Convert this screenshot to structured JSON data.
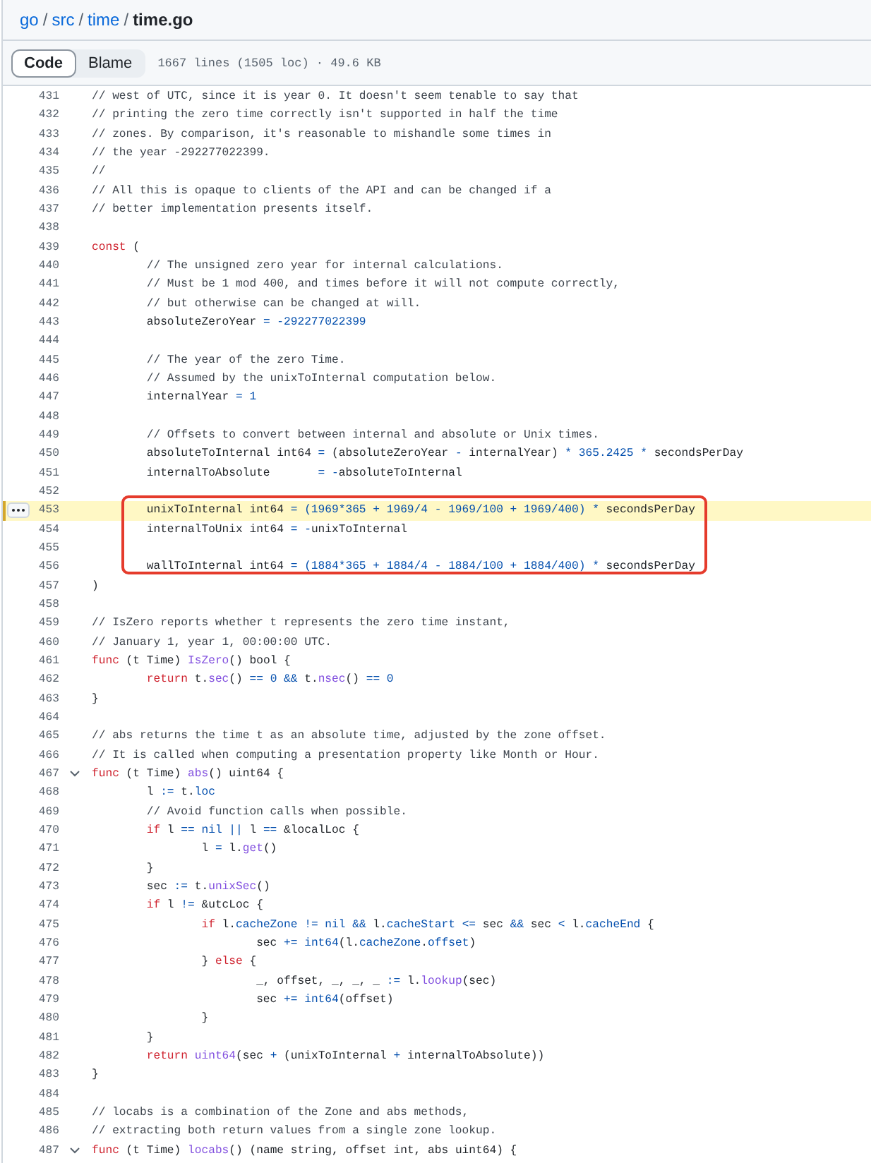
{
  "breadcrumb": {
    "items": [
      "go",
      "src",
      "time",
      "time.go"
    ],
    "separator": "/"
  },
  "tabs": [
    {
      "label": "Code",
      "selected": true
    },
    {
      "label": "Blame",
      "selected": false
    }
  ],
  "file_info": "1667 lines (1505 loc) · 49.6 KB",
  "code": {
    "lines": [
      {
        "number": "431",
        "selected": false,
        "boxed": false,
        "tokens": [
          {
            "kind": "comment",
            "text": "// west of UTC, since it is year 0. It doesn't seem tenable to say that"
          }
        ]
      },
      {
        "number": "432",
        "selected": false,
        "boxed": false,
        "tokens": [
          {
            "kind": "comment",
            "text": "// printing the zero time correctly isn't supported in half the time"
          }
        ]
      },
      {
        "number": "433",
        "selected": false,
        "boxed": false,
        "tokens": [
          {
            "kind": "comment",
            "text": "// zones. By comparison, it's reasonable to mishandle some times in"
          }
        ]
      },
      {
        "number": "434",
        "selected": false,
        "boxed": false,
        "tokens": [
          {
            "kind": "comment",
            "text": "// the year -292277022399."
          }
        ]
      },
      {
        "number": "435",
        "selected": false,
        "boxed": false,
        "tokens": [
          {
            "kind": "comment",
            "text": "//"
          }
        ]
      },
      {
        "number": "436",
        "selected": false,
        "boxed": false,
        "tokens": [
          {
            "kind": "comment",
            "text": "// All this is opaque to clients of the API and can be changed if a"
          }
        ]
      },
      {
        "number": "437",
        "selected": false,
        "boxed": false,
        "tokens": [
          {
            "kind": "comment",
            "text": "// better implementation presents itself."
          }
        ]
      },
      {
        "number": "438",
        "selected": false,
        "boxed": false
      },
      {
        "number": "439",
        "selected": false,
        "boxed": false,
        "tokens": [
          {
            "kind": "keyword",
            "text": "const"
          },
          {
            "kind": "plain",
            "text": " ("
          }
        ]
      },
      {
        "number": "440",
        "selected": false,
        "boxed": false,
        "tokens": [
          {
            "kind": "comment",
            "text": "\t// The unsigned zero year for internal calculations."
          }
        ]
      },
      {
        "number": "441",
        "selected": false,
        "boxed": false,
        "tokens": [
          {
            "kind": "comment",
            "text": "\t// Must be 1 mod 400, and times before it will not compute correctly,"
          }
        ]
      },
      {
        "number": "442",
        "selected": false,
        "boxed": false,
        "tokens": [
          {
            "kind": "comment",
            "text": "\t// but otherwise can be changed at will."
          }
        ]
      },
      {
        "number": "443",
        "selected": false,
        "boxed": false,
        "tokens": [
          {
            "kind": "plain",
            "text": "\tabsoluteZeroYear "
          },
          {
            "kind": "literal",
            "text": "= -292277022399"
          }
        ]
      },
      {
        "number": "444",
        "selected": false,
        "boxed": false
      },
      {
        "number": "445",
        "selected": false,
        "boxed": false,
        "tokens": [
          {
            "kind": "comment",
            "text": "\t// The year of the zero Time."
          }
        ]
      },
      {
        "number": "446",
        "selected": false,
        "boxed": false,
        "tokens": [
          {
            "kind": "comment",
            "text": "\t// Assumed by the unixToInternal computation below."
          }
        ]
      },
      {
        "number": "447",
        "selected": false,
        "boxed": false,
        "tokens": [
          {
            "kind": "plain",
            "text": "\tinternalYear "
          },
          {
            "kind": "literal",
            "text": "= 1"
          }
        ]
      },
      {
        "number": "448",
        "selected": false,
        "boxed": false
      },
      {
        "number": "449",
        "selected": false,
        "boxed": false,
        "tokens": [
          {
            "kind": "comment",
            "text": "\t// Offsets to convert between internal and absolute or Unix times."
          }
        ]
      },
      {
        "number": "450",
        "selected": false,
        "boxed": false,
        "tokens": [
          {
            "kind": "plain",
            "text": "\tabsoluteToInternal int64 "
          },
          {
            "kind": "literal",
            "text": "="
          },
          {
            "kind": "plain",
            "text": " (absoluteZeroYear "
          },
          {
            "kind": "literal",
            "text": "-"
          },
          {
            "kind": "plain",
            "text": " internalYear) "
          },
          {
            "kind": "literal",
            "text": "* 365.2425 *"
          },
          {
            "kind": "plain",
            "text": " secondsPerDay"
          }
        ]
      },
      {
        "number": "451",
        "selected": false,
        "boxed": false,
        "tokens": [
          {
            "kind": "plain",
            "text": "\tinternalToAbsolute       "
          },
          {
            "kind": "literal",
            "text": "= -"
          },
          {
            "kind": "plain",
            "text": "absoluteToInternal"
          }
        ]
      },
      {
        "number": "452",
        "selected": false,
        "boxed": false
      },
      {
        "number": "453",
        "selected": true,
        "boxed": true,
        "tokens": [
          {
            "kind": "plain",
            "text": "\tunixToInternal int64 "
          },
          {
            "kind": "literal",
            "text": "= (1969*365 + 1969/4 - 1969/100 + 1969/400) *"
          },
          {
            "kind": "plain",
            "text": " secondsPerDay"
          }
        ]
      },
      {
        "number": "454",
        "selected": false,
        "boxed": true,
        "tokens": [
          {
            "kind": "plain",
            "text": "\tinternalToUnix int64 "
          },
          {
            "kind": "literal",
            "text": "= -"
          },
          {
            "kind": "plain",
            "text": "unixToInternal"
          }
        ]
      },
      {
        "number": "455",
        "selected": false,
        "boxed": true
      },
      {
        "number": "456",
        "selected": false,
        "boxed": true,
        "tokens": [
          {
            "kind": "plain",
            "text": "\twallToInternal int64 "
          },
          {
            "kind": "literal",
            "text": "= (1884*365 + 1884/4 - 1884/100 + 1884/400) *"
          },
          {
            "kind": "plain",
            "text": " secondsPerDay"
          }
        ]
      },
      {
        "number": "457",
        "selected": false,
        "boxed": false,
        "tokens": [
          {
            "kind": "plain",
            "text": ")"
          }
        ]
      },
      {
        "number": "458",
        "selected": false,
        "boxed": false
      },
      {
        "number": "459",
        "selected": false,
        "boxed": false,
        "tokens": [
          {
            "kind": "comment",
            "text": "// IsZero reports whether t represents the zero time instant,"
          }
        ]
      },
      {
        "number": "460",
        "selected": false,
        "boxed": false,
        "tokens": [
          {
            "kind": "comment",
            "text": "// January 1, year 1, 00:00:00 UTC."
          }
        ]
      },
      {
        "number": "461",
        "selected": false,
        "boxed": false,
        "tokens": [
          {
            "kind": "keyword",
            "text": "func"
          },
          {
            "kind": "plain",
            "text": " (t Time) "
          },
          {
            "kind": "call",
            "text": "IsZero"
          },
          {
            "kind": "plain",
            "text": "() bool {"
          }
        ]
      },
      {
        "number": "462",
        "selected": false,
        "boxed": false,
        "tokens": [
          {
            "kind": "keyword",
            "text": "\treturn"
          },
          {
            "kind": "plain",
            "text": " t."
          },
          {
            "kind": "call",
            "text": "sec"
          },
          {
            "kind": "plain",
            "text": "() "
          },
          {
            "kind": "literal",
            "text": "== 0 &&"
          },
          {
            "kind": "plain",
            "text": " t."
          },
          {
            "kind": "call",
            "text": "nsec"
          },
          {
            "kind": "plain",
            "text": "() "
          },
          {
            "kind": "literal",
            "text": "== 0"
          }
        ]
      },
      {
        "number": "463",
        "selected": false,
        "boxed": false,
        "tokens": [
          {
            "kind": "plain",
            "text": "}"
          }
        ]
      },
      {
        "number": "464",
        "selected": false,
        "boxed": false
      },
      {
        "number": "465",
        "selected": false,
        "boxed": false,
        "tokens": [
          {
            "kind": "comment",
            "text": "// abs returns the time t as an absolute time, adjusted by the zone offset."
          }
        ]
      },
      {
        "number": "466",
        "selected": false,
        "boxed": false,
        "tokens": [
          {
            "kind": "comment",
            "text": "// It is called when computing a presentation property like Month or Hour."
          }
        ]
      },
      {
        "number": "467",
        "selected": false,
        "boxed": false,
        "expanded": true,
        "tokens": [
          {
            "kind": "keyword",
            "text": "func"
          },
          {
            "kind": "plain",
            "text": " (t Time) "
          },
          {
            "kind": "call",
            "text": "abs"
          },
          {
            "kind": "plain",
            "text": "() uint64 {"
          }
        ]
      },
      {
        "number": "468",
        "selected": false,
        "boxed": false,
        "tokens": [
          {
            "kind": "plain",
            "text": "\tl "
          },
          {
            "kind": "literal",
            "text": ":="
          },
          {
            "kind": "plain",
            "text": " t."
          },
          {
            "kind": "literal",
            "text": "loc"
          }
        ]
      },
      {
        "number": "469",
        "selected": false,
        "boxed": false,
        "tokens": [
          {
            "kind": "comment",
            "text": "\t// Avoid function calls when possible."
          }
        ]
      },
      {
        "number": "470",
        "selected": false,
        "boxed": false,
        "tokens": [
          {
            "kind": "keyword",
            "text": "\tif"
          },
          {
            "kind": "plain",
            "text": " l "
          },
          {
            "kind": "literal",
            "text": "== nil ||"
          },
          {
            "kind": "plain",
            "text": " l "
          },
          {
            "kind": "literal",
            "text": "=="
          },
          {
            "kind": "plain",
            "text": " &localLoc {"
          }
        ]
      },
      {
        "number": "471",
        "selected": false,
        "boxed": false,
        "tokens": [
          {
            "kind": "plain",
            "text": "\t\tl "
          },
          {
            "kind": "literal",
            "text": "="
          },
          {
            "kind": "plain",
            "text": " l."
          },
          {
            "kind": "call",
            "text": "get"
          },
          {
            "kind": "plain",
            "text": "()"
          }
        ]
      },
      {
        "number": "472",
        "selected": false,
        "boxed": false,
        "tokens": [
          {
            "kind": "plain",
            "text": "\t}"
          }
        ]
      },
      {
        "number": "473",
        "selected": false,
        "boxed": false,
        "tokens": [
          {
            "kind": "plain",
            "text": "\tsec "
          },
          {
            "kind": "literal",
            "text": ":="
          },
          {
            "kind": "plain",
            "text": " t."
          },
          {
            "kind": "call",
            "text": "unixSec"
          },
          {
            "kind": "plain",
            "text": "()"
          }
        ]
      },
      {
        "number": "474",
        "selected": false,
        "boxed": false,
        "tokens": [
          {
            "kind": "keyword",
            "text": "\tif"
          },
          {
            "kind": "plain",
            "text": " l "
          },
          {
            "kind": "literal",
            "text": "!="
          },
          {
            "kind": "plain",
            "text": " &utcLoc {"
          }
        ]
      },
      {
        "number": "475",
        "selected": false,
        "boxed": false,
        "tokens": [
          {
            "kind": "keyword",
            "text": "\t\tif"
          },
          {
            "kind": "plain",
            "text": " l."
          },
          {
            "kind": "literal",
            "text": "cacheZone != nil &&"
          },
          {
            "kind": "plain",
            "text": " l."
          },
          {
            "kind": "literal",
            "text": "cacheStart <="
          },
          {
            "kind": "plain",
            "text": " sec "
          },
          {
            "kind": "literal",
            "text": "&&"
          },
          {
            "kind": "plain",
            "text": " sec "
          },
          {
            "kind": "literal",
            "text": "<"
          },
          {
            "kind": "plain",
            "text": " l."
          },
          {
            "kind": "literal",
            "text": "cacheEnd"
          },
          {
            "kind": "plain",
            "text": " {"
          }
        ]
      },
      {
        "number": "476",
        "selected": false,
        "boxed": false,
        "tokens": [
          {
            "kind": "plain",
            "text": "\t\t\tsec "
          },
          {
            "kind": "literal",
            "text": "+= int64"
          },
          {
            "kind": "plain",
            "text": "(l."
          },
          {
            "kind": "literal",
            "text": "cacheZone"
          },
          {
            "kind": "plain",
            "text": "."
          },
          {
            "kind": "literal",
            "text": "offset"
          },
          {
            "kind": "plain",
            "text": ")"
          }
        ]
      },
      {
        "number": "477",
        "selected": false,
        "boxed": false,
        "tokens": [
          {
            "kind": "plain",
            "text": "\t\t} "
          },
          {
            "kind": "keyword",
            "text": "else"
          },
          {
            "kind": "plain",
            "text": " {"
          }
        ]
      },
      {
        "number": "478",
        "selected": false,
        "boxed": false,
        "tokens": [
          {
            "kind": "plain",
            "text": "\t\t\t_, offset, _, _, _ "
          },
          {
            "kind": "literal",
            "text": ":="
          },
          {
            "kind": "plain",
            "text": " l."
          },
          {
            "kind": "call",
            "text": "lookup"
          },
          {
            "kind": "plain",
            "text": "(sec)"
          }
        ]
      },
      {
        "number": "479",
        "selected": false,
        "boxed": false,
        "tokens": [
          {
            "kind": "plain",
            "text": "\t\t\tsec "
          },
          {
            "kind": "literal",
            "text": "+= int64"
          },
          {
            "kind": "plain",
            "text": "(offset)"
          }
        ]
      },
      {
        "number": "480",
        "selected": false,
        "boxed": false,
        "tokens": [
          {
            "kind": "plain",
            "text": "\t\t}"
          }
        ]
      },
      {
        "number": "481",
        "selected": false,
        "boxed": false,
        "tokens": [
          {
            "kind": "plain",
            "text": "\t}"
          }
        ]
      },
      {
        "number": "482",
        "selected": false,
        "boxed": false,
        "tokens": [
          {
            "kind": "keyword",
            "text": "\treturn"
          },
          {
            "kind": "call",
            "text": " uint64"
          },
          {
            "kind": "plain",
            "text": "(sec "
          },
          {
            "kind": "literal",
            "text": "+"
          },
          {
            "kind": "plain",
            "text": " (unixToInternal "
          },
          {
            "kind": "literal",
            "text": "+"
          },
          {
            "kind": "plain",
            "text": " internalToAbsolute))"
          }
        ]
      },
      {
        "number": "483",
        "selected": false,
        "boxed": false,
        "tokens": [
          {
            "kind": "plain",
            "text": "}"
          }
        ]
      },
      {
        "number": "484",
        "selected": false,
        "boxed": false
      },
      {
        "number": "485",
        "selected": false,
        "boxed": false,
        "tokens": [
          {
            "kind": "comment",
            "text": "// locabs is a combination of the Zone and abs methods,"
          }
        ]
      },
      {
        "number": "486",
        "selected": false,
        "boxed": false,
        "tokens": [
          {
            "kind": "comment",
            "text": "// extracting both return values from a single zone lookup."
          }
        ]
      },
      {
        "number": "487",
        "selected": false,
        "boxed": false,
        "expanded": true,
        "tokens": [
          {
            "kind": "keyword",
            "text": "func"
          },
          {
            "kind": "plain",
            "text": " (t Time) "
          },
          {
            "kind": "call",
            "text": "locabs"
          },
          {
            "kind": "plain",
            "text": "() (name string, offset int, abs uint64) {"
          }
        ]
      }
    ]
  }
}
